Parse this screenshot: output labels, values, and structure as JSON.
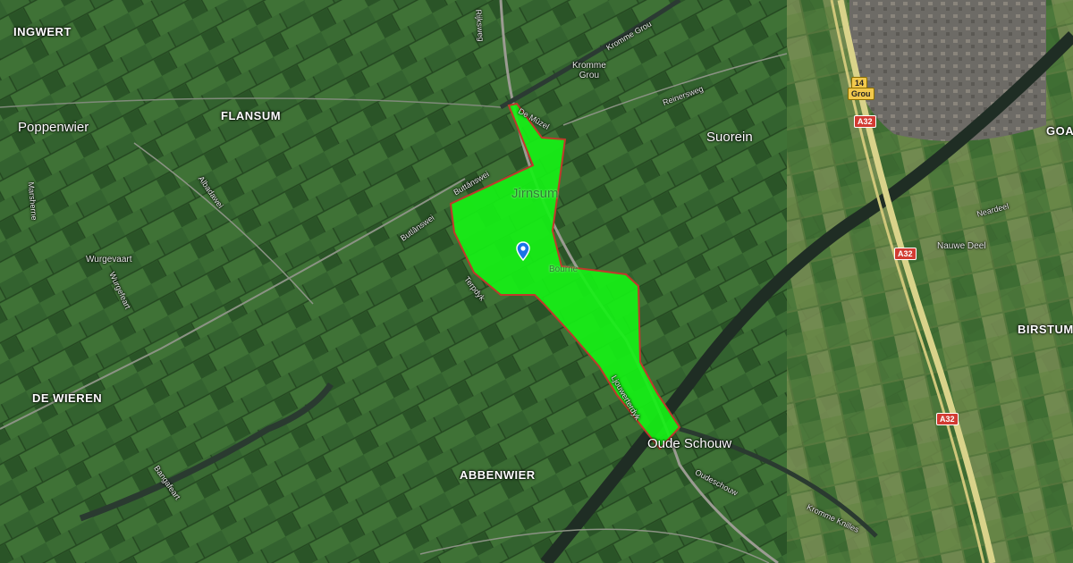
{
  "map": {
    "type": "satellite",
    "highlight_color": "#16f016",
    "highlight_border": "#c0392b",
    "marker_color": "#1a73e8",
    "places": [
      {
        "key": "ingwert",
        "text": "INGWERT"
      },
      {
        "key": "flansum",
        "text": "FLANSUM"
      },
      {
        "key": "de_wieren",
        "text": "DE WIEREN"
      },
      {
        "key": "abbenwier",
        "text": "ABBENWIER"
      },
      {
        "key": "birstum",
        "text": "BIRSTUM"
      },
      {
        "key": "goa",
        "text": "GOA"
      }
    ],
    "towns": [
      {
        "key": "poppenwier",
        "text": "Poppenwier"
      },
      {
        "key": "suorein",
        "text": "Suorein"
      },
      {
        "key": "oude_schouw",
        "text": "Oude Schouw"
      },
      {
        "key": "jirnsum",
        "text": "Jirnsum"
      }
    ],
    "small_labels": [
      {
        "key": "kromme_grou",
        "text": "Kromme\nGrou"
      },
      {
        "key": "wurgevaart",
        "text": "Wurgevaart"
      },
      {
        "key": "nauwe_deel",
        "text": "Nauwe Deel"
      },
      {
        "key": "bourne",
        "text": "Bourne"
      }
    ],
    "roads": [
      {
        "key": "rijksweg",
        "text": "Rijksweg"
      },
      {
        "key": "de_muzel",
        "text": "De Mûzel"
      },
      {
        "key": "krommegrou",
        "text": "Kromme Grou"
      },
      {
        "key": "reinersweg",
        "text": "Reinersweg"
      },
      {
        "key": "albadawei",
        "text": "Albadawei"
      },
      {
        "key": "butlansweg",
        "text": "Butlânswei"
      },
      {
        "key": "marshorne",
        "text": "Marsherne"
      },
      {
        "key": "wurgefeart",
        "text": "Wurgefeart"
      },
      {
        "key": "bangafeart",
        "text": "Bangafeart"
      },
      {
        "key": "oudeschouw",
        "text": "Oudeschouw"
      },
      {
        "key": "kromme_knilles",
        "text": "Kromme Knilles"
      },
      {
        "key": "neardeel",
        "text": "Neardeel"
      },
      {
        "key": "ljouwerterdyk",
        "text": "Ljouwerterdyk"
      },
      {
        "key": "terpdijk",
        "text": "Terpdyk"
      },
      {
        "key": "buttansweg",
        "text": "Buttânswei"
      }
    ],
    "shields": [
      {
        "key": "n14",
        "text": "14"
      },
      {
        "key": "grou",
        "text": "Grou"
      },
      {
        "key": "a32_1",
        "text": "A32"
      },
      {
        "key": "a32_2",
        "text": "A32"
      },
      {
        "key": "a32_3",
        "text": "A32"
      }
    ]
  }
}
